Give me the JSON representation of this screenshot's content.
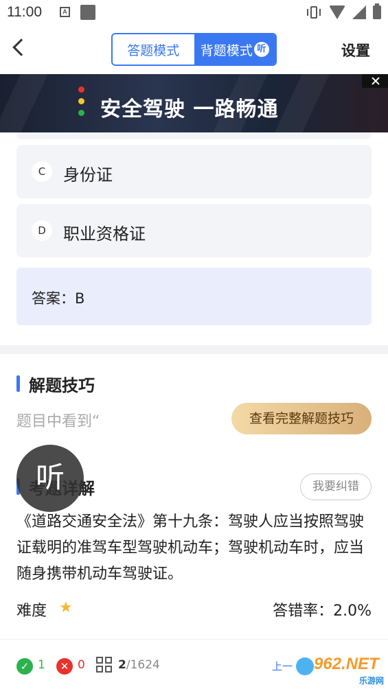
{
  "status_bar": {
    "time": "11:00",
    "a_label": "A"
  },
  "header": {
    "back": "back",
    "modes": [
      {
        "label": "答题模式",
        "active": false
      },
      {
        "label": "背题模式",
        "active": true,
        "badge": "听"
      }
    ],
    "settings_label": "设置"
  },
  "ad": {
    "text": "安全驾驶 一路畅通"
  },
  "options": [
    {
      "letter": "C",
      "text": "身份证"
    },
    {
      "letter": "D",
      "text": "职业资格证"
    }
  ],
  "answer": {
    "text": "答案：B"
  },
  "tips": {
    "title": "解题技巧",
    "preview": "题目中看到“",
    "button_label": "查看完整解题技巧"
  },
  "explanation": {
    "title": "考题详解",
    "fix_label": "我要纠错",
    "text": "《道路交通安全法》第十九条：驾驶人应当按照驾驶证载明的准驾车型驾驶机动车；驾驶机动车时，应当随身携带机动车驾驶证。"
  },
  "difficulty": {
    "label": "难度",
    "stars": 1,
    "error_rate": "答错率：2.0%"
  },
  "listen_float": {
    "label": "听"
  },
  "bottom_bar": {
    "correct_count": "1",
    "wrong_count": "0",
    "current": "2",
    "total": "/1624",
    "prev_label": "上一题",
    "watermark_text": "962.NET",
    "watermark_sub": "乐游网"
  },
  "colors": {
    "accent": "#3a78f2",
    "correct": "#2bb24c",
    "wrong": "#e8332a",
    "star": "#f5b731"
  }
}
